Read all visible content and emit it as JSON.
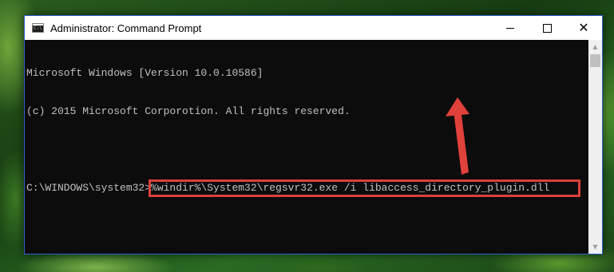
{
  "window": {
    "title": "Administrator: Command Prompt",
    "icon_label": "C:\\",
    "controls": {
      "minimize": "minimize-icon",
      "maximize": "maximize-icon",
      "close": "close-icon",
      "close_glyph": "✕"
    }
  },
  "console": {
    "lines": [
      "Microsoft Windows [Version 10.0.10586]",
      "(c) 2015 Microsoft Corporotion. All rights reserved.",
      ""
    ],
    "prompt": "C:\\WINDOWS\\system32>",
    "command": "%windir%\\System32\\regsvr32.exe /i libaccess_directory_plugin.dll"
  },
  "scrollbar": {
    "up_glyph": "▲",
    "down_glyph": "▼"
  },
  "colors": {
    "highlight_box": "#d9413a",
    "arrow": "#e0413b",
    "console_bg": "#0c0c0c",
    "console_text": "#c0c0c0"
  }
}
